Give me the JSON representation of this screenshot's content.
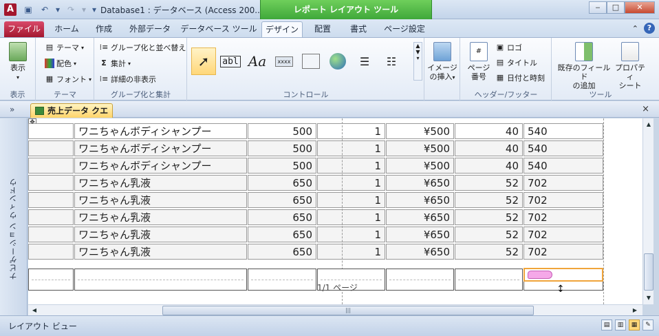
{
  "window": {
    "app_icon": "A",
    "title": "Database1 : データベース (Access 200...",
    "context_tab": "レポート レイアウト ツール"
  },
  "ribbon_tabs": [
    "ファイル",
    "ホーム",
    "作成",
    "外部データ",
    "データベース ツール",
    "デザイン",
    "配置",
    "書式",
    "ページ設定"
  ],
  "ribbon": {
    "view_group": {
      "button": "表示",
      "label": "表示"
    },
    "theme_group": {
      "theme": "テーマ",
      "colors": "配色",
      "fonts": "フォント",
      "label": "テーマ"
    },
    "group_group": {
      "group_sort": "グループ化と並べ替え",
      "totals": "集計",
      "hide_details": "詳細の非表示",
      "label": "グループ化と集計"
    },
    "controls_group": {
      "label": "コントロール",
      "textbox": "abl",
      "label_ctrl": "Aa",
      "button": "xxxx"
    },
    "insert_image": {
      "line1": "イメージ",
      "line2": "の挿入"
    },
    "header_group": {
      "page_number_line1": "ページ",
      "page_number_line2": "番号",
      "logo": "ロゴ",
      "title": "タイトル",
      "datetime": "日付と時刻",
      "label": "ヘッダー/フッター"
    },
    "tools_group": {
      "add_fields_line1": "既存のフィールド",
      "add_fields_line2": "の追加",
      "property_line1": "プロパティ",
      "property_line2": "シート",
      "label": "ツール"
    }
  },
  "document": {
    "nav_toggle": "»",
    "tab_title": "売上データ クエリ",
    "close": "×",
    "nav_pane_label": "ナビゲーション ウィンドウ"
  },
  "report_rows": [
    {
      "name": "ワニちゃんボディシャンプー",
      "price": "500",
      "qty": "1",
      "amount": "¥500",
      "tax": "40",
      "total": "540"
    },
    {
      "name": "ワニちゃんボディシャンプー",
      "price": "500",
      "qty": "1",
      "amount": "¥500",
      "tax": "40",
      "total": "540"
    },
    {
      "name": "ワニちゃんボディシャンプー",
      "price": "500",
      "qty": "1",
      "amount": "¥500",
      "tax": "40",
      "total": "540"
    },
    {
      "name": "ワニちゃん乳液",
      "price": "650",
      "qty": "1",
      "amount": "¥650",
      "tax": "52",
      "total": "702"
    },
    {
      "name": "ワニちゃん乳液",
      "price": "650",
      "qty": "1",
      "amount": "¥650",
      "tax": "52",
      "total": "702"
    },
    {
      "name": "ワニちゃん乳液",
      "price": "650",
      "qty": "1",
      "amount": "¥650",
      "tax": "52",
      "total": "702"
    },
    {
      "name": "ワニちゃん乳液",
      "price": "650",
      "qty": "1",
      "amount": "¥650",
      "tax": "52",
      "total": "702"
    },
    {
      "name": "ワニちゃん乳液",
      "price": "650",
      "qty": "1",
      "amount": "¥650",
      "tax": "52",
      "total": "702"
    }
  ],
  "footer": {
    "page_text": "1/1 ページ"
  },
  "status": {
    "view_name": "レイアウト ビュー"
  }
}
